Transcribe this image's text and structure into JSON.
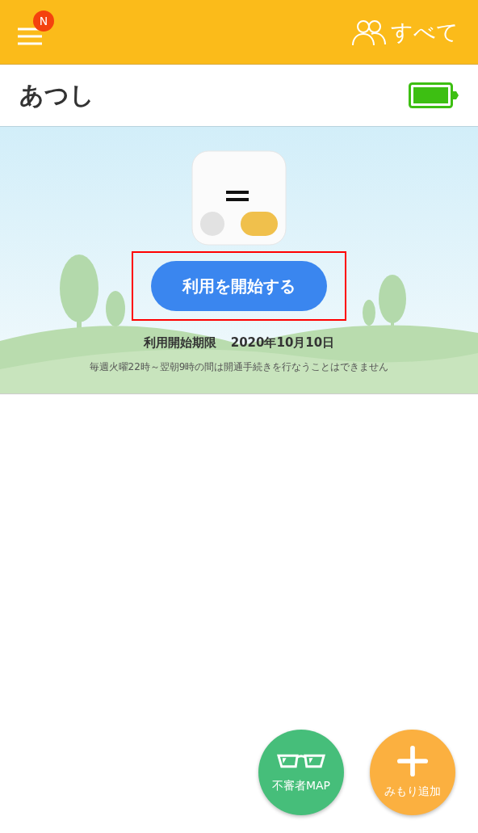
{
  "header": {
    "menu_badge": "N",
    "filter_label": "すべて"
  },
  "device": {
    "name": "あつし"
  },
  "activation": {
    "button": "利用を開始する",
    "highlighted": true,
    "deadline_label": "利用開始期限",
    "deadline_date": "2020年10月10日",
    "note": "毎週火曜22時～翌朝9時の間は開通手続きを行なうことはできません"
  },
  "actions": [
    {
      "kind": "map",
      "label": "不審者MAP",
      "color": "#46be7a"
    },
    {
      "kind": "add",
      "label": "みもり追加",
      "color": "#fbb040"
    }
  ]
}
